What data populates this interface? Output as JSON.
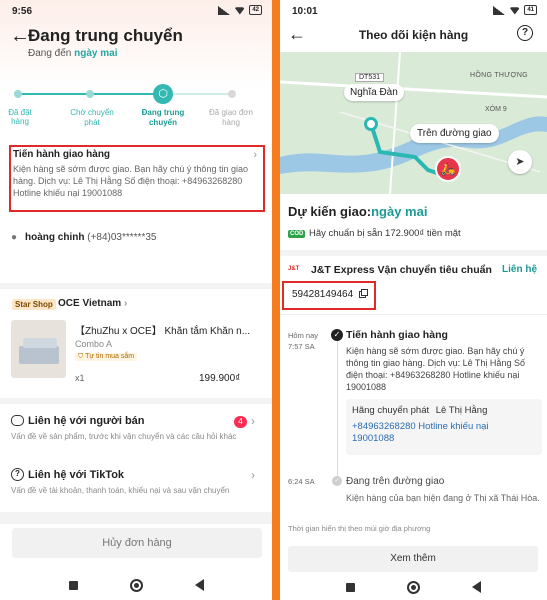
{
  "left": {
    "status": {
      "time": "9:56",
      "battery": "42"
    },
    "header": {
      "title": "Đang trung chuyển",
      "subtitle_prefix": "Đang đến",
      "subtitle_highlight": "ngày mai"
    },
    "steps": [
      {
        "label": "Đã đặt hàng"
      },
      {
        "label": "Chờ chuyển phát"
      },
      {
        "label": "Đang trung chuyển"
      },
      {
        "label": "Đã giao đơn hàng"
      }
    ],
    "delivery_update": {
      "title": "Tiến hành giao hàng",
      "text": "Kiện hàng sẽ sớm được giao. Bạn hãy chú ý thông tin giao hàng. Dịch vụ: Lê Thị Hằng Số điện thoại: +84963268280 Hotline khiếu nại 19001088"
    },
    "address": {
      "name": "hoàng chinh",
      "phone": "(+84)03******35"
    },
    "shop": {
      "badge": "Star Shop",
      "name": "OCE Vietnam"
    },
    "product": {
      "title": "【ZhuZhu x OCE】 Khăn tắm Khăn n...",
      "variant": "Combo A",
      "tag": "Tự tin mua sắm",
      "qty": "x1",
      "price": "199.900₫"
    },
    "contact_seller": {
      "title": "Liên hệ với người bán",
      "sub": "Vấn đề về sản phẩm, trước khi vận chuyển và các câu hỏi khác",
      "badge": "4"
    },
    "contact_tiktok": {
      "title": "Liên hệ với TikTok",
      "sub": "Vấn đề về tài khoản, thanh toán, khiếu nại và sau vận chuyển"
    },
    "cancel_button": "Hủy đơn hàng"
  },
  "right": {
    "status": {
      "time": "10:01",
      "battery": "41"
    },
    "header": {
      "title": "Theo dõi kiện hàng"
    },
    "map": {
      "road": "DT531",
      "place1": "Nghĩa Đàn",
      "place2": "HỒNG THƯỢNG",
      "place3": "XÓM 9",
      "bubble": "Trên đường giao"
    },
    "eta": {
      "prefix": "Dự kiến giao:",
      "value": "ngày mai"
    },
    "cod": {
      "badge": "COD",
      "text": "Hãy chuẩn bị sẵn 172.900₫ tiền mặt"
    },
    "carrier": {
      "logo": "J&T",
      "name": "J&T Express Vận chuyển tiêu chuẩn",
      "contact": "Liên hệ"
    },
    "tracking_number": "59428149464",
    "timeline": [
      {
        "date": "Hôm nay",
        "time": "7:57 SA",
        "title": "Tiến hành giao hàng",
        "text": "Kiện hàng sẽ sớm được giao. Bạn hãy chú ý thông tin giao hàng. Dịch vụ: Lê Thị Hằng Số điện thoại: +84963268280 Hotline khiếu nại 19001088"
      },
      {
        "date": "",
        "time": "6:24 SA",
        "title": "Đang trên đường giao",
        "text": "Kiện hàng của bạn hiện đang ở Thị xã Thái Hòa."
      }
    ],
    "courier_card": {
      "label": "Hãng chuyển phát",
      "name": "Lê Thị Hằng",
      "phone": "+84963268280 Hotline khiếu nại 19001088"
    },
    "note": "Thời gian hiển thị theo múi giờ địa phương",
    "see_more": "Xem thêm"
  }
}
